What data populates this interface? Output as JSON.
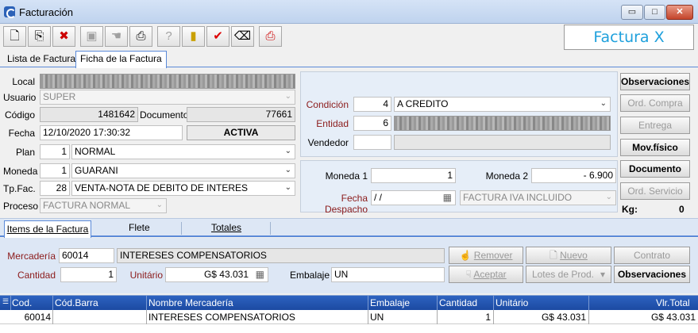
{
  "window": {
    "title": "Facturación",
    "minimize": "▭",
    "maximize": "□",
    "close": "✕"
  },
  "brand": {
    "text": "Factura X"
  },
  "toolbar": {
    "icons": [
      "new-icon",
      "copy-icon",
      "delete-icon",
      "save-icon",
      "hand-icon",
      "print-icon",
      "help-icon",
      "exit-icon",
      "check-icon",
      "eraser-icon",
      "print-red-icon"
    ]
  },
  "tabs": {
    "list": "Lista de Facturas",
    "ficha": "Ficha de la Factura"
  },
  "form": {
    "local_label": "Local",
    "usuario_label": "Usuario",
    "usuario_value": "SUPER",
    "codigo_label": "Código",
    "codigo_value": "1481642",
    "documento_label": "Documento",
    "documento_value": "77661",
    "fecha_label": "Fecha",
    "fecha_value": "12/10/2020 17:30:32",
    "estado": "ACTIVA",
    "plan_label": "Plan",
    "plan_num": "1",
    "plan_value": "NORMAL",
    "moneda_label": "Moneda",
    "moneda_num": "1",
    "moneda_value": "GUARANI",
    "tpfac_label": "Tp.Fac.",
    "tpfac_num": "28",
    "tpfac_value": "VENTA-NOTA DE DEBITO DE INTERES",
    "proceso_label": "Proceso",
    "proceso_value": "FACTURA NORMAL"
  },
  "right": {
    "condicion_label": "Condición",
    "condicion_num": "4",
    "condicion_value": "A CREDITO",
    "entidad_label": "Entidad",
    "entidad_num": "6",
    "vendedor_label": "Vendedor",
    "moneda1_label": "Moneda 1",
    "moneda1_value": "1",
    "moneda2_label": "Moneda 2",
    "moneda2_value": "- 6.900",
    "fecha_despacho_label": "Fecha Despacho",
    "fecha_despacho_value": " /  /",
    "iva_value": "FACTURA IVA INCLUIDO"
  },
  "side_buttons": {
    "observaciones": "Observaciones",
    "ord_compra": "Ord. Compra",
    "entrega": "Entrega",
    "mov_fisico": "Mov.físico",
    "documento": "Documento",
    "ord_servicio": "Ord. Servicio",
    "kg_label": "Kg:",
    "kg_value": "0"
  },
  "tabs2": {
    "items": "Items de la Factura",
    "flete": "Flete",
    "totales": "Totales"
  },
  "items_form": {
    "mercaderia_label": "Mercadería",
    "mercaderia_code": "60014",
    "mercaderia_name": "INTERESES COMPENSATORIOS",
    "cantidad_label": "Cantidad",
    "cantidad_value": "1",
    "unitario_label": "Unitário",
    "unitario_value": "G$ 43.031",
    "embalaje_label": "Embalaje",
    "embalaje_value": "UN",
    "remover": "Remover",
    "nuevo": "Nuevo",
    "contrato": "Contrato",
    "aceptar": "Aceptar",
    "lotes": "Lotes de Prod.",
    "observaciones": "Observaciones"
  },
  "grid": {
    "headers": [
      "Cod.",
      "Cód.Barra",
      "Nombre Mercadería",
      "Embalaje",
      "Cantidad",
      "Unitário",
      "Vlr.Total"
    ],
    "row": [
      "60014",
      "",
      "INTERESES COMPENSATORIOS",
      "UN",
      "1",
      "G$ 43.031",
      "G$ 43.031"
    ]
  }
}
